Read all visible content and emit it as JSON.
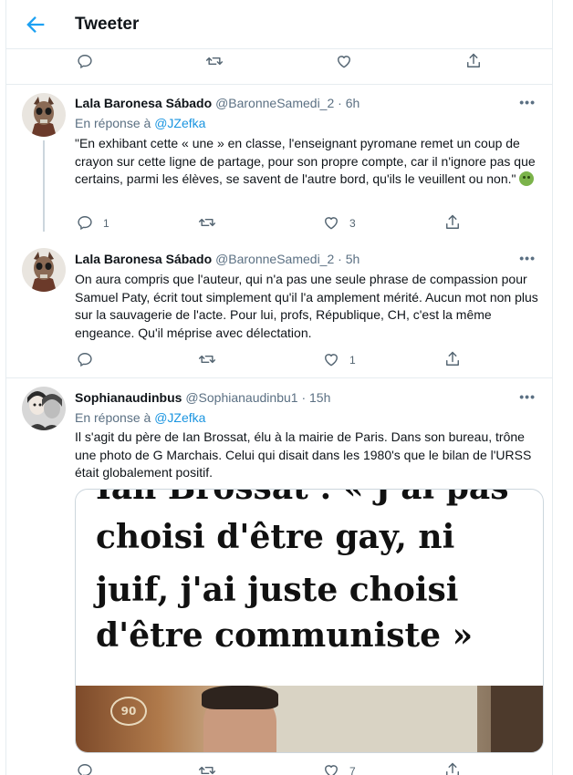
{
  "header": {
    "title": "Tweeter"
  },
  "tweets": [
    {
      "name": "Lala Baronesa Sábado",
      "handle": "@BaronneSamedi_2",
      "dot": "·",
      "time": "6h",
      "reply_prefix": "En réponse à",
      "reply_to": "@JZefka",
      "text": "\"En exhibant cette « une » en classe, l'enseignant pyromane remet un coup de crayon sur cette ligne de partage, pour son propre compte, car il n'ignore pas que certains, parmi les élèves, se savent de l'autre bord, qu'ils le veuillent ou non.\"",
      "replies": "1",
      "retweets": "",
      "likes": "3"
    },
    {
      "name": "Lala Baronesa Sábado",
      "handle": "@BaronneSamedi_2",
      "dot": "·",
      "time": "5h",
      "text": "On aura compris que l'auteur, qui n'a pas une seule phrase de compassion pour Samuel Paty, écrit tout simplement qu'il l'a amplement mérité. Aucun mot non plus sur la sauvagerie de l'acte. Pour lui, profs, République, CH, c'est la même engeance. Qu'il méprise avec délectation.",
      "replies": "",
      "retweets": "",
      "likes": "1"
    },
    {
      "name": "Sophianaudinbus",
      "handle": "@Sophianaudinbu1",
      "dot": "·",
      "time": "15h",
      "reply_prefix": "En réponse à",
      "reply_to": "@JZefka",
      "text": "Il s'agit du père de Ian Brossat, élu à la mairie de Paris. Dans son bureau, trône une photo de G Marchais. Celui qui disait dans les 1980's que le bilan de l'URSS était globalement positif.",
      "media_lines": [
        "Ian Brossat : « J'ai pas",
        "choisi d'être gay, ni",
        "juif, j'ai juste choisi",
        "d'être communiste »"
      ],
      "media_badge": "90",
      "replies": "",
      "retweets": "",
      "likes": "7"
    }
  ],
  "more_label": "•••",
  "icons": [
    "back-arrow-icon",
    "reply-icon",
    "retweet-icon",
    "like-icon",
    "share-icon",
    "more-icon"
  ],
  "colors": {
    "accent": "#1da1f2",
    "link": "#1b95e0",
    "muted": "#5b7083",
    "border": "#e6ecf0"
  }
}
